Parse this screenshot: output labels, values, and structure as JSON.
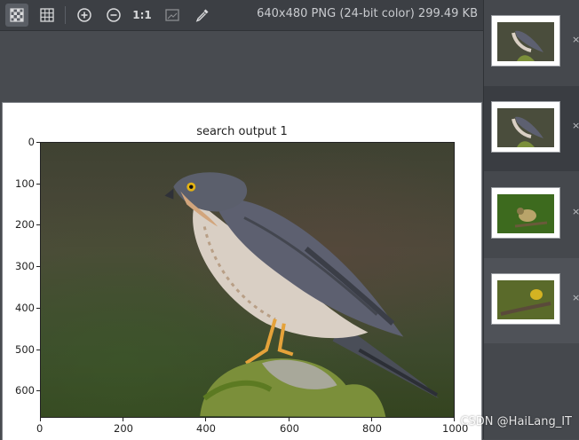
{
  "toolbar": {
    "buttons": [
      {
        "name": "checkerboard-icon",
        "label": ""
      },
      {
        "name": "grid-icon",
        "label": ""
      },
      {
        "name": "zoom-in-icon",
        "label": ""
      },
      {
        "name": "zoom-out-icon",
        "label": ""
      },
      {
        "name": "actual-size",
        "label": "1:1"
      },
      {
        "name": "fit-window-icon",
        "label": ""
      },
      {
        "name": "eyedropper-icon",
        "label": ""
      }
    ],
    "image_info": "640x480 PNG (24-bit color) 299.49 KB"
  },
  "plot": {
    "title": "search output 1",
    "y_ticks": [
      "0",
      "100",
      "200",
      "300",
      "400",
      "500",
      "600"
    ],
    "x_ticks": [
      "0",
      "200",
      "400",
      "600",
      "800",
      "1000"
    ]
  },
  "chart_data": {
    "type": "other",
    "title": "search output 1",
    "x_ticks": [
      0,
      200,
      400,
      600,
      800,
      1000
    ],
    "y_ticks": [
      0,
      100,
      200,
      300,
      400,
      500,
      600
    ],
    "xlim": [
      0,
      1000
    ],
    "ylim": [
      665,
      0
    ]
  },
  "thumbnails": [
    {
      "name": "thumbnail-1",
      "state": "normal",
      "close": "×"
    },
    {
      "name": "thumbnail-2",
      "state": "selected",
      "close": "×"
    },
    {
      "name": "thumbnail-3",
      "state": "normal",
      "close": "×"
    },
    {
      "name": "thumbnail-4",
      "state": "hovered",
      "close": "×"
    }
  ],
  "watermark": "CSDN @HaiLang_IT",
  "colors": {
    "background": "#484b50",
    "toolbar": "#3c3f44",
    "panel": "#45484d"
  }
}
